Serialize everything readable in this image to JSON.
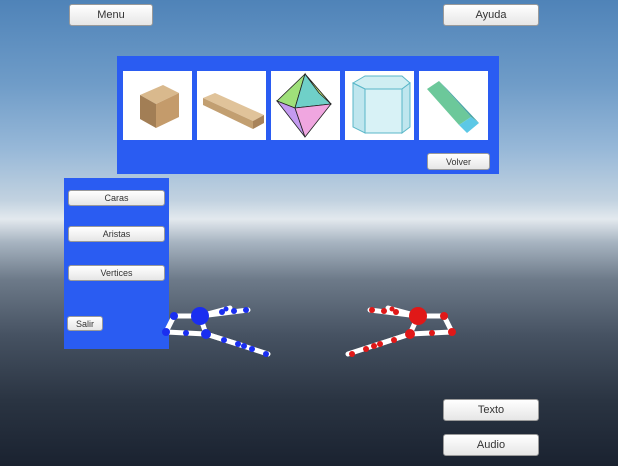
{
  "top_bar": {
    "menu_label": "Menu",
    "help_label": "Ayuda"
  },
  "gallery": {
    "items": [
      {
        "icon": "cube-icon"
      },
      {
        "icon": "wooden-beam-icon"
      },
      {
        "icon": "octahedron-icon"
      },
      {
        "icon": "hexagonal-prism-icon"
      },
      {
        "icon": "oblique-prism-icon"
      }
    ],
    "back_label": "Volver",
    "color": "#2a5cf2"
  },
  "side_panel": {
    "faces_label": "Caras",
    "edges_label": "Aristas",
    "vertices_label": "Vertices",
    "exit_label": "Salir"
  },
  "bottom_right": {
    "text_label": "Texto",
    "audio_label": "Audio"
  },
  "hands": {
    "left_color": "#1a2ef0",
    "right_color": "#e01818"
  }
}
